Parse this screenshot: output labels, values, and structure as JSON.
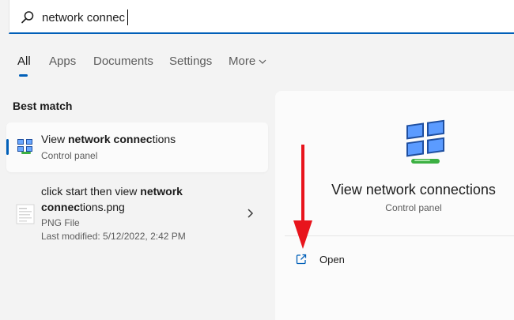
{
  "search": {
    "value": "network connec",
    "placeholder": ""
  },
  "tabs": [
    {
      "label": "All",
      "active": true
    },
    {
      "label": "Apps"
    },
    {
      "label": "Documents"
    },
    {
      "label": "Settings"
    },
    {
      "label": "More"
    }
  ],
  "section_title": "Best match",
  "results": [
    {
      "title_parts": [
        "View ",
        "network connec",
        "tions"
      ],
      "subtitle": "Control panel",
      "icon": "network-connections-icon",
      "selected": true
    },
    {
      "title_line1_parts": [
        "click start then view ",
        "network"
      ],
      "title_line2_parts": [
        "connec",
        "tions.png"
      ],
      "type": "PNG File",
      "modified": "Last modified: 5/12/2022, 2:42 PM",
      "icon": "image-file-icon"
    }
  ],
  "preview": {
    "title": "View network connections",
    "subtitle": "Control panel",
    "icon": "network-connections-icon",
    "actions": [
      {
        "label": "Open",
        "icon": "open-external-icon"
      }
    ]
  },
  "colors": {
    "accent": "#005fb8",
    "annotation_arrow": "#e8141c"
  }
}
